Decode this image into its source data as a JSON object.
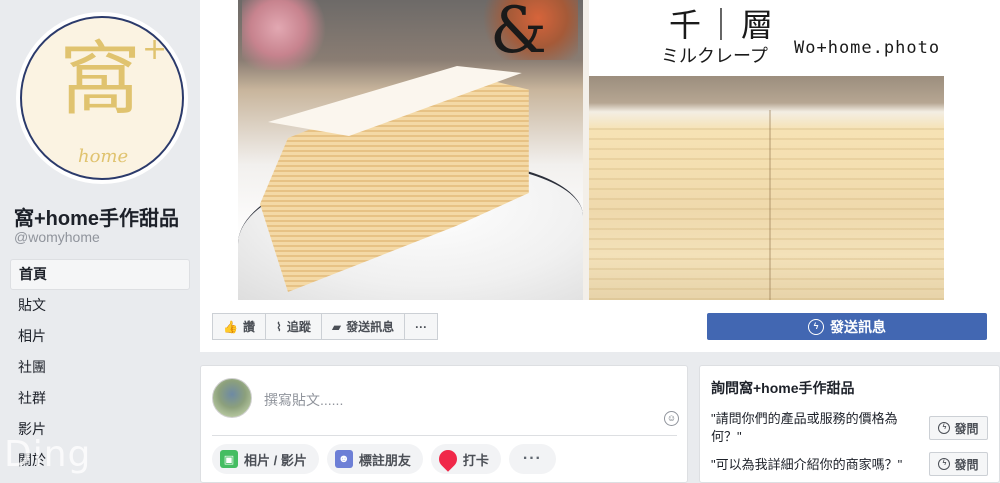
{
  "page": {
    "logo_glyph": "窩",
    "logo_plus": "+",
    "logo_sub": "home",
    "name": "窩+home手作甜品",
    "handle": "@womyhome"
  },
  "sidebar": {
    "items": [
      {
        "label": "首頁",
        "active": true
      },
      {
        "label": "貼文"
      },
      {
        "label": "相片"
      },
      {
        "label": "社團"
      },
      {
        "label": "社群"
      },
      {
        "label": "影片"
      },
      {
        "label": "關於"
      }
    ]
  },
  "watermark": "Ding",
  "cover": {
    "brand_title": "千｜層",
    "brand_jp": "ミルクレープ",
    "brand_site": "Wo+home.photo",
    "amp": "&"
  },
  "actions": {
    "like": "讚",
    "follow": "追蹤",
    "send": "發送訊息",
    "more": "···"
  },
  "message_button": "發送訊息",
  "composer": {
    "placeholder": "撰寫貼文......",
    "chips": [
      "相片 / 影片",
      "標註朋友",
      "打卡"
    ],
    "more": "···"
  },
  "ask": {
    "title": "詢問窩+home手作甜品",
    "questions": [
      "\"請問你們的產品或服務的價格為何？\"",
      "\"可以為我詳細介紹你的商家嗎？\""
    ],
    "ask_label": "發問"
  },
  "colors": {
    "primary": "#4267b2",
    "background": "#e9ebee",
    "logo_gold": "#e0c36f",
    "logo_ring": "#2b3a6b"
  }
}
